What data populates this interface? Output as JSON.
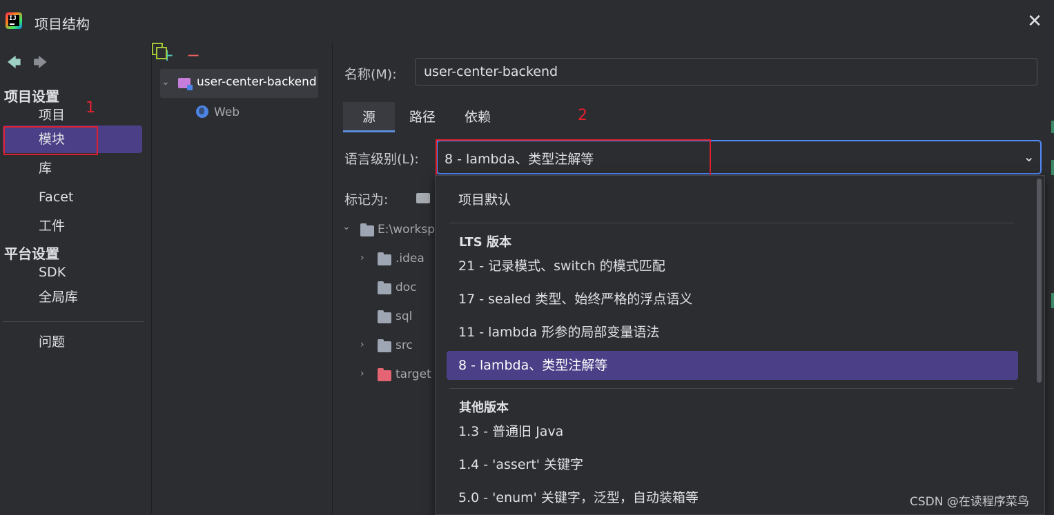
{
  "window": {
    "title": "项目结构",
    "close_glyph": "✕"
  },
  "nav": {
    "back_glyph": "🡄",
    "forward_glyph": "🡆",
    "project_settings_header": "项目设置",
    "project_settings_items": [
      {
        "label": "项目"
      },
      {
        "label": "模块",
        "selected": true
      },
      {
        "label": "库"
      },
      {
        "label": "Facet"
      },
      {
        "label": "工件"
      }
    ],
    "platform_settings_header": "平台设置",
    "platform_settings_items": [
      {
        "label": "SDK"
      },
      {
        "label": "全局库"
      }
    ],
    "problems_label": "问题"
  },
  "annotations": {
    "marker_1": "1",
    "marker_2": "2"
  },
  "modules": {
    "add_glyph": "+",
    "remove_glyph": "−",
    "root": {
      "label": "user-center-backend",
      "expanded": true
    },
    "facets": [
      {
        "label": "Web"
      }
    ]
  },
  "module_settings": {
    "name_label": "名称(M):",
    "name_value": "user-center-backend",
    "tabs": [
      {
        "label": "源",
        "active": true
      },
      {
        "label": "路径"
      },
      {
        "label": "依赖"
      }
    ],
    "language_level_label": "语言级别(L):",
    "language_level_value": "8 - lambda、类型注解等",
    "mark_as_label": "标记为:",
    "content_tree": [
      {
        "label": "E:\\workspa",
        "expanded": true,
        "depth": 0
      },
      {
        "label": ".idea",
        "expandable": true,
        "depth": 1
      },
      {
        "label": "doc",
        "depth": 1
      },
      {
        "label": "sql",
        "depth": 1
      },
      {
        "label": "src",
        "expandable": true,
        "depth": 1
      },
      {
        "label": "target",
        "expandable": true,
        "depth": 1,
        "excluded": true
      }
    ]
  },
  "language_dropdown": {
    "project_default": "项目默认",
    "lts_header": "LTS 版本",
    "lts_items": [
      {
        "label": "21 - 记录模式、switch 的模式匹配"
      },
      {
        "label": "17 - sealed 类型、始终严格的浮点语义"
      },
      {
        "label": "11 - lambda 形参的局部变量语法"
      },
      {
        "label": "8 - lambda、类型注解等",
        "selected": true
      }
    ],
    "other_header": "其他版本",
    "other_items": [
      {
        "label": "1.3 - 普通旧 Java"
      },
      {
        "label": "1.4 - 'assert' 关键字"
      },
      {
        "label": "5.0 - 'enum' 关键字，泛型，自动装箱等"
      }
    ]
  },
  "watermark": "CSDN @在读程序菜鸟",
  "colors": {
    "selection": "#4b3f87",
    "focus_border": "#548af7",
    "annotation": "#e0202f"
  }
}
